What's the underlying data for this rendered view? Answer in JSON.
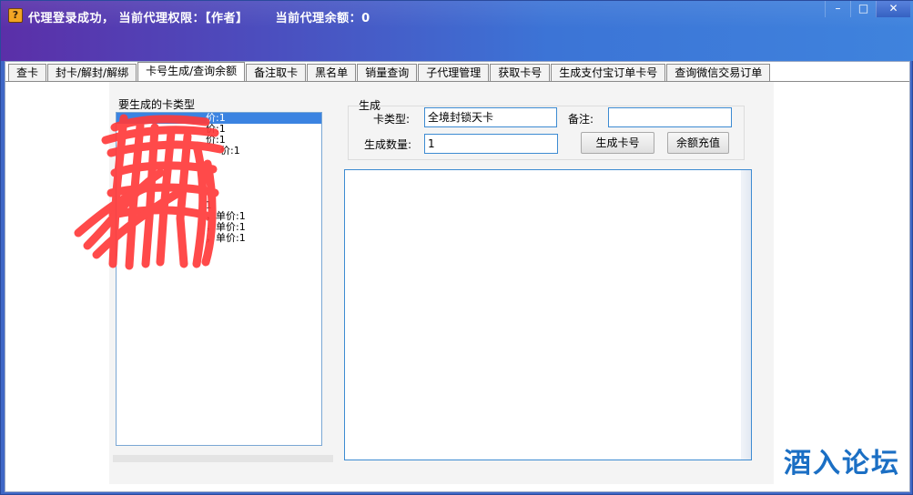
{
  "window": {
    "title": "代理登录成功， 当前代理权限：【作者】      当前代理余额：0",
    "icon": "question-app-icon",
    "controls": [
      "minimize",
      "maximize",
      "close"
    ]
  },
  "tabs": [
    {
      "label": "查卡",
      "active": false
    },
    {
      "label": "封卡/解封/解绑",
      "active": false
    },
    {
      "label": "卡号生成/查询余额",
      "active": true
    },
    {
      "label": "备注取卡",
      "active": false
    },
    {
      "label": "黑名单",
      "active": false
    },
    {
      "label": "销量查询",
      "active": false
    },
    {
      "label": "子代理管理",
      "active": false
    },
    {
      "label": "获取卡号",
      "active": false
    },
    {
      "label": "生成支付宝订单卡号",
      "active": false
    },
    {
      "label": "查询微信交易订单",
      "active": false
    }
  ],
  "card_types": {
    "label": "要生成的卡类型",
    "items": [
      {
        "text": "价:1",
        "selected": true
      },
      {
        "text": "价:1",
        "selected": false
      },
      {
        "text": "价:1",
        "selected": false
      },
      {
        "text": "价:1",
        "selected": false
      },
      {
        "text": "",
        "selected": false
      },
      {
        "text": "",
        "selected": false
      },
      {
        "text": "",
        "selected": false
      },
      {
        "text": "",
        "selected": false
      },
      {
        "text": "1",
        "selected": false
      },
      {
        "text": "，单价:1",
        "selected": false
      },
      {
        "text": "，单价:1",
        "selected": false
      },
      {
        "text": "，单价:1",
        "selected": false
      }
    ]
  },
  "generate": {
    "group_label": "生成",
    "card_type_label": "卡类型:",
    "card_type_value": "全境封锁天卡",
    "note_label": "备注:",
    "note_value": "",
    "count_label": "生成数量:",
    "count_value": "1",
    "generate_button": "生成卡号",
    "recharge_button": "余额充值"
  },
  "output_text": "",
  "watermark": "酒入论坛",
  "colors": {
    "title_gradient_start": "#5b2fa8",
    "title_gradient_end": "#3f83dd",
    "selection": "#3b83e1",
    "input_border": "#3d8bd2",
    "watermark": "#1b6fc4",
    "scribble": "#ff3b3b"
  }
}
